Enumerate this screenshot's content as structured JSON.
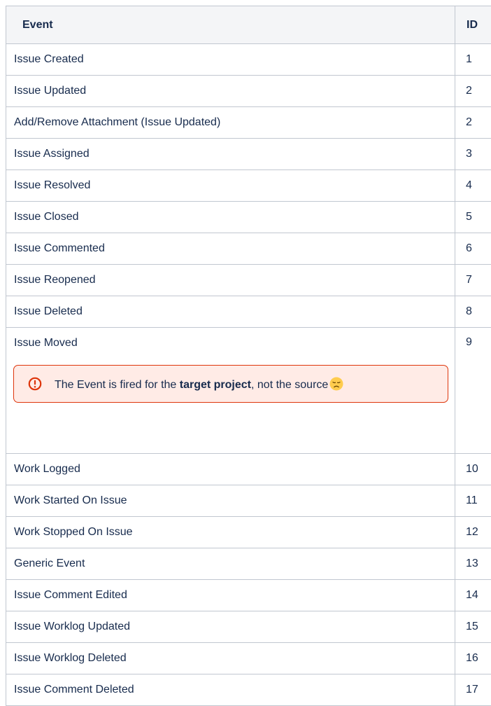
{
  "table": {
    "headers": {
      "event": "Event",
      "id": "ID"
    },
    "rows": [
      {
        "event": "Issue Created",
        "id": "1"
      },
      {
        "event": "Issue Updated",
        "id": "2"
      },
      {
        "event": "Add/Remove Attachment (Issue Updated)",
        "id": "2"
      },
      {
        "event": "Issue Assigned",
        "id": "3"
      },
      {
        "event": "Issue Resolved",
        "id": "4"
      },
      {
        "event": "Issue Closed",
        "id": "5"
      },
      {
        "event": "Issue Commented",
        "id": "6"
      },
      {
        "event": "Issue Reopened",
        "id": "7"
      },
      {
        "event": "Issue Deleted",
        "id": "8"
      },
      {
        "event": "Issue Moved",
        "id": "9"
      },
      {
        "event": "Work Logged",
        "id": "10"
      },
      {
        "event": "Work Started On Issue",
        "id": "11"
      },
      {
        "event": "Work Stopped On Issue",
        "id": "12"
      },
      {
        "event": "Generic Event",
        "id": "13"
      },
      {
        "event": "Issue Comment Edited",
        "id": "14"
      },
      {
        "event": "Issue Worklog Updated",
        "id": "15"
      },
      {
        "event": "Issue Worklog Deleted",
        "id": "16"
      },
      {
        "event": "Issue Comment Deleted",
        "id": "17"
      }
    ]
  },
  "moved_note": {
    "icon": "error-icon",
    "text_before": "The Event is fired for the ",
    "text_bold": "target project",
    "text_after": ", not the source",
    "emoji": "disappointed-face-icon"
  },
  "colors": {
    "header_bg": "#f4f5f7",
    "border": "#c1c7d0",
    "error_border": "#de350b",
    "error_bg": "#ffebe6",
    "error_icon": "#de350b",
    "emoji": "#ffcc4d"
  }
}
